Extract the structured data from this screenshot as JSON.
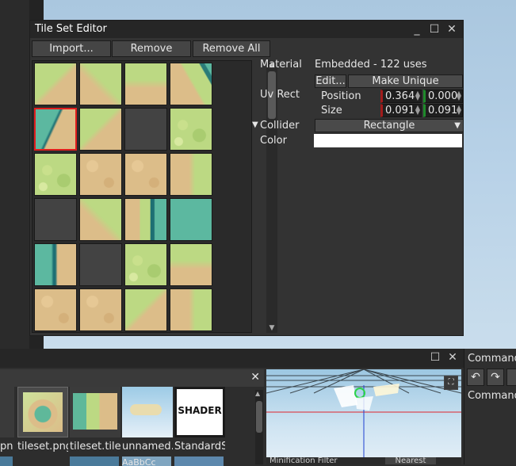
{
  "tile_set_editor": {
    "title": "Tile Set Editor",
    "toolbar": {
      "import": "Import...",
      "remove": "Remove",
      "remove_all": "Remove All"
    },
    "inspector": {
      "material_label": "Material",
      "material_value": "Embedded - 122 uses",
      "edit_button": "Edit...",
      "make_unique_button": "Make Unique",
      "uv_rect_label": "Uv Rect",
      "position_label": "Position",
      "position_x": "0.364",
      "position_y": "0.000",
      "size_label": "Size",
      "size_x": "0.091",
      "size_y": "0.091",
      "collider_label": "Collider",
      "collider_value": "Rectangle",
      "color_label": "Color",
      "color_value": "#ffffff"
    }
  },
  "asset_browser": {
    "items": [
      {
        "label": "pn",
        "icon": "image-icon"
      },
      {
        "label": "tileset.png",
        "icon": "image-icon"
      },
      {
        "label": "tileset.tiles",
        "icon": "tileset-icon"
      },
      {
        "label": "unnamed.",
        "icon": "key-icon"
      },
      {
        "label": "StandardS",
        "icon": "shader-icon"
      }
    ],
    "shader_badge": "SHADER",
    "next_row_label": "AaBbCc",
    "filter_label": "Minification Filter",
    "filter_value": "Nearest"
  },
  "command_panel": {
    "title": "Command",
    "item": "Command"
  },
  "colors": {
    "selection": "#e11d1d",
    "accent_red": "#a11b1b",
    "accent_green": "#1f8a2b"
  }
}
